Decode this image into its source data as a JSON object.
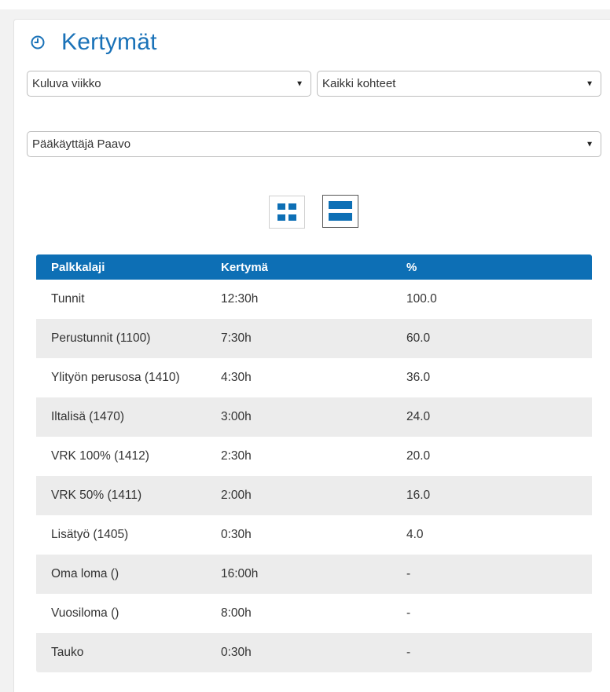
{
  "header": {
    "title": "Kertymät"
  },
  "filters": {
    "period": "Kuluva viikko",
    "targets": "Kaikki kohteet",
    "user": "Pääkäyttäjä Paavo"
  },
  "icons": {
    "clock": "clock-icon",
    "grid_view": "grid-view-icon",
    "list_view": "list-view-icon",
    "dropdown": "triangle-down"
  },
  "colors": {
    "accent": "#0d6fb5",
    "title": "#1a72b8",
    "row_alt": "#ececec"
  },
  "table": {
    "headers": [
      "Palkkalaji",
      "Kertymä",
      "%"
    ],
    "rows": [
      [
        "Tunnit",
        "12:30h",
        "100.0"
      ],
      [
        "Perustunnit (1100)",
        "7:30h",
        "60.0"
      ],
      [
        "Ylityön perusosa (1410)",
        "4:30h",
        "36.0"
      ],
      [
        "Iltalisä (1470)",
        "3:00h",
        "24.0"
      ],
      [
        "VRK 100% (1412)",
        "2:30h",
        "20.0"
      ],
      [
        "VRK 50% (1411)",
        "2:00h",
        "16.0"
      ],
      [
        "Lisätyö (1405)",
        "0:30h",
        "4.0"
      ],
      [
        "Oma loma ()",
        "16:00h",
        "-"
      ],
      [
        "Vuosiloma ()",
        "8:00h",
        "-"
      ],
      [
        "Tauko",
        "0:30h",
        "-"
      ]
    ]
  }
}
